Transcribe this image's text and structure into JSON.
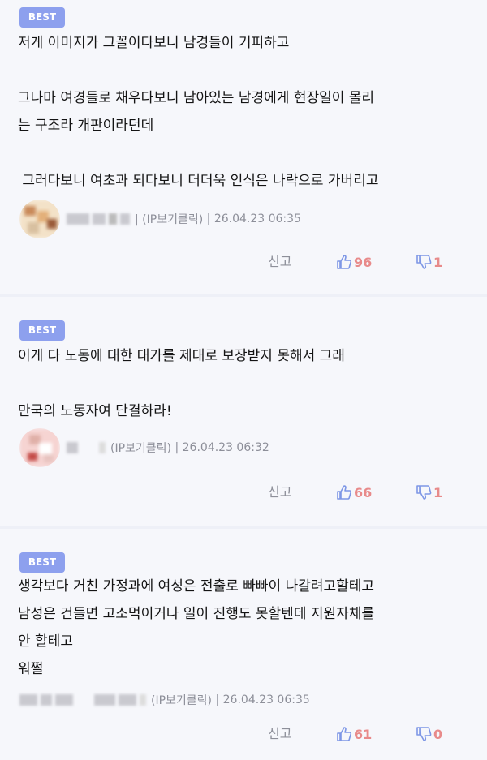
{
  "comments": [
    {
      "badge": "BEST",
      "text": "저게 이미지가 그꼴이다보니 남경들이 기피하고\n\n그나마 여경들로 채우다보니 남아있는 남경에게 현장일이 몰리\n는 구조라 개판이라던데\n\n 그러다보니 여초과 되다보니 더더욱 인식은 나락으로 가버리고",
      "ip_label": "(IP보기클릭)",
      "timestamp": "26.04.23 06:35",
      "report_label": "신고",
      "likes": "96",
      "dislikes": "1"
    },
    {
      "badge": "BEST",
      "text": "이게 다 노동에 대한 대가를 제대로 보장받지 못해서 그래\n\n만국의 노동자여 단결하라!",
      "ip_label": "(IP보기클릭)",
      "timestamp": "26.04.23 06:32",
      "report_label": "신고",
      "likes": "66",
      "dislikes": "1"
    },
    {
      "badge": "BEST",
      "text": "생각보다 거친 가정과에 여성은 전출로 빠빠이 나갈려고할테고\n남성은 건들면 고소먹이거나 일이 진행도 못할텐데 지원자체를\n안 할테고\n워쩔",
      "ip_label": "(IP보기클릭)",
      "timestamp": "26.04.23 06:35",
      "report_label": "신고",
      "likes": "61",
      "dislikes": "0"
    }
  ],
  "colors": {
    "badge": "#8da0ee",
    "like_icon": "#7e97e6",
    "count": "#e88a8a",
    "meta": "#8d8f99"
  }
}
